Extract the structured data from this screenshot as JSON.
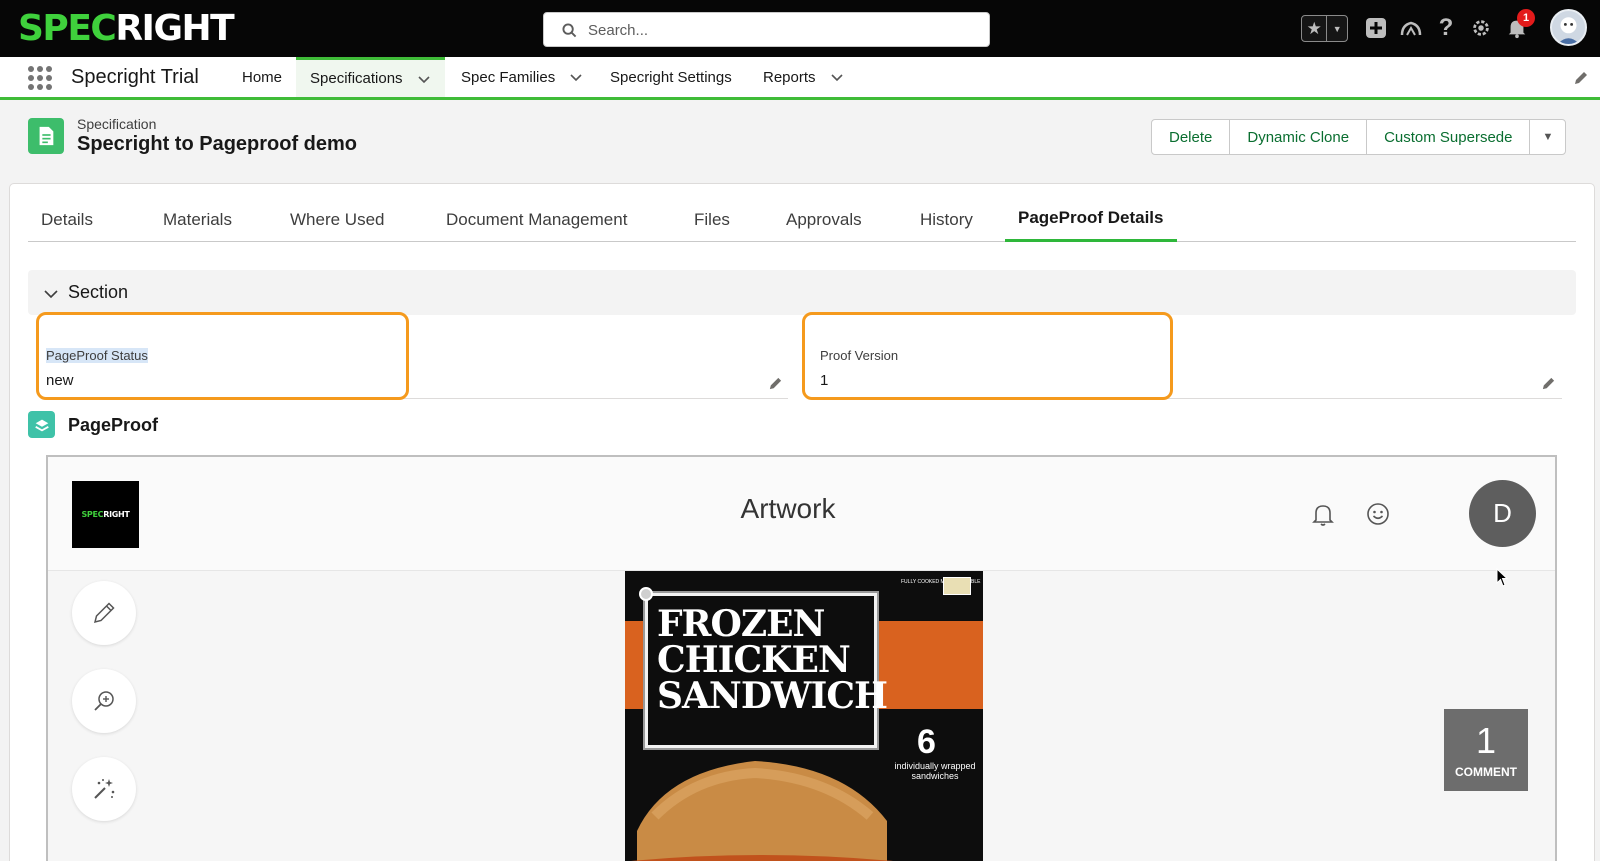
{
  "header": {
    "logo_part1": "SPEC",
    "logo_part2": "RIGHT",
    "search_placeholder": "Search...",
    "notification_count": "1",
    "icons": [
      "star-icon",
      "chevron-down-icon",
      "add-icon",
      "trailhead-icon",
      "help-icon",
      "gear-icon",
      "bell-icon",
      "avatar"
    ]
  },
  "nav": {
    "app_name": "Specright Trial",
    "items": [
      {
        "label": "Home"
      },
      {
        "label": "Specifications"
      },
      {
        "label": "Spec Families"
      },
      {
        "label": "Specright Settings"
      },
      {
        "label": "Reports"
      }
    ]
  },
  "record": {
    "type": "Specification",
    "title": "Specright to Pageproof demo",
    "actions": [
      "Delete",
      "Dynamic Clone",
      "Custom Supersede"
    ]
  },
  "tabs": [
    {
      "label": "Details"
    },
    {
      "label": "Materials"
    },
    {
      "label": "Where Used"
    },
    {
      "label": "Document Management"
    },
    {
      "label": "Files"
    },
    {
      "label": "Approvals"
    },
    {
      "label": "History"
    },
    {
      "label": "PageProof Details"
    }
  ],
  "section": {
    "label": "Section",
    "fields": [
      {
        "label": "PageProof Status",
        "value": "new"
      },
      {
        "label": "Proof Version",
        "value": "1"
      }
    ]
  },
  "pageproof": {
    "label": "PageProof",
    "viewer": {
      "logo_part1": "SPEC",
      "logo_part2": "RIGHT",
      "title": "Artwork",
      "avatar_initial": "D",
      "comment_count": "1",
      "comment_label": "COMMENT",
      "tools": [
        "pencil-icon",
        "zoom-icon",
        "magic-wand-icon"
      ]
    },
    "proof": {
      "title_lines": [
        "FROZEN",
        "CHICKEN",
        "SANDWICH"
      ],
      "count": "6",
      "count_caption": "individually wrapped sandwiches",
      "tag": "FULLY COOKED MICROWAVABLE"
    }
  },
  "colors": {
    "brand_green": "#3fd13c",
    "nav_accent": "#3fbc38",
    "highlight_orange": "#f59a1d",
    "button_text": "#0a6e30"
  }
}
